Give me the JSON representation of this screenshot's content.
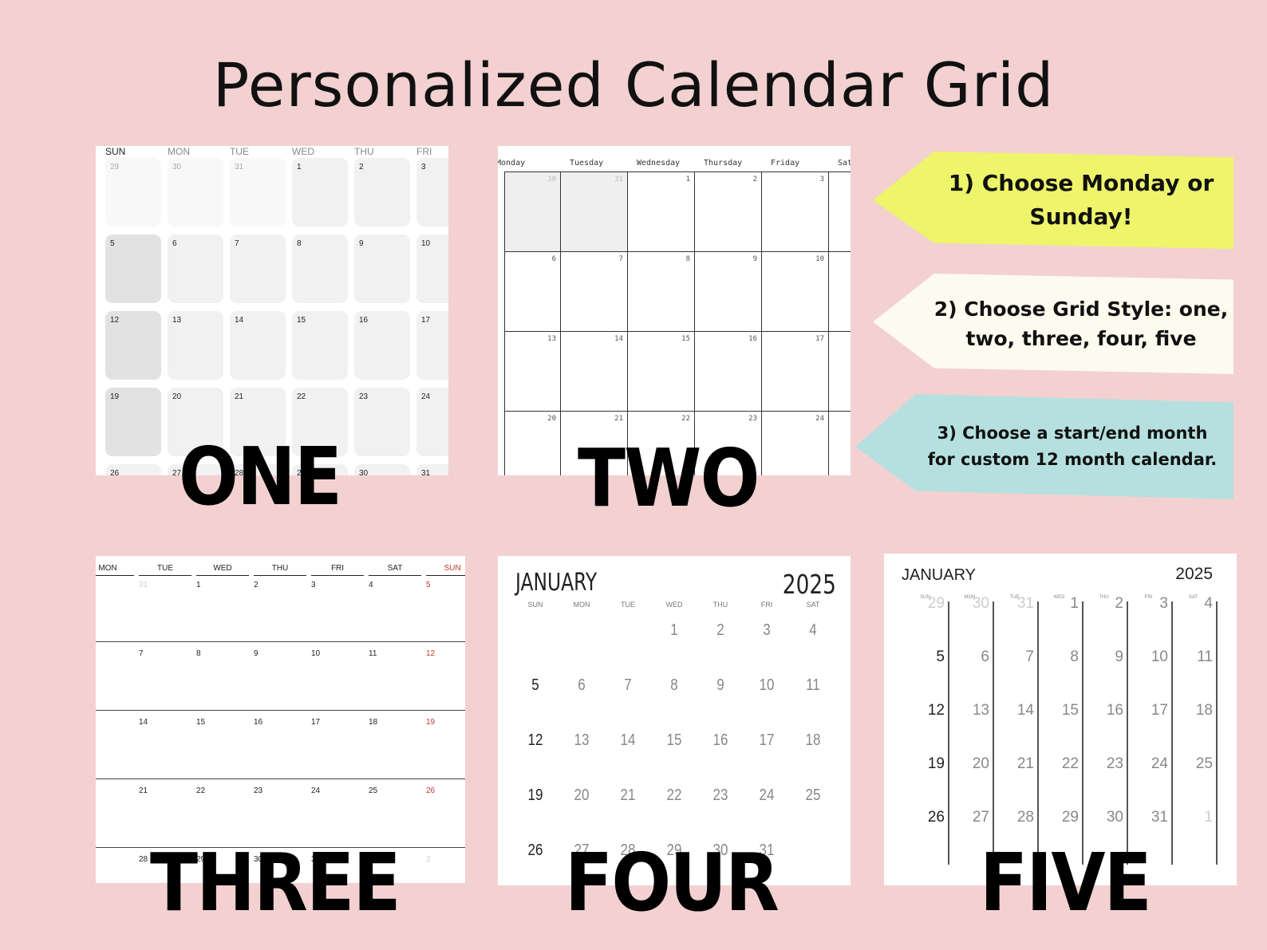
{
  "title": "Personalized Calendar Grid",
  "labels": {
    "one": "ONE",
    "two": "TWO",
    "three": "THREE",
    "four": "FOUR",
    "five": "FIVE"
  },
  "steps": [
    {
      "line1": "1) Choose Monday or",
      "line2": "Sunday!",
      "color": "#eef56a"
    },
    {
      "line1": "2) Choose Grid Style: one,",
      "line2": "two, three, four, five",
      "color": "#fdfaef"
    },
    {
      "line1": "3) Choose a start/end month",
      "line2": "for custom 12 month calendar.",
      "color": "#b5e0df"
    }
  ],
  "calendar": {
    "month": "JANUARY",
    "year": "2025",
    "p1_headers": [
      "SUN",
      "MON",
      "TUE",
      "WED",
      "THU",
      "FRI"
    ],
    "p1_rows": [
      [
        "29",
        "30",
        "31",
        "1",
        "2",
        "3"
      ],
      [
        "5",
        "6",
        "7",
        "8",
        "9",
        "10"
      ],
      [
        "12",
        "13",
        "14",
        "15",
        "16",
        "17"
      ],
      [
        "19",
        "20",
        "21",
        "22",
        "23",
        "24"
      ],
      [
        "26",
        "27",
        "28",
        "29",
        "30",
        "31"
      ]
    ],
    "p2_headers": [
      "Monday",
      "Tuesday",
      "Wednesday",
      "Thursday",
      "Friday",
      "Sat"
    ],
    "p2_rows": [
      [
        "30",
        "31",
        "1",
        "2",
        "3",
        ""
      ],
      [
        "6",
        "7",
        "8",
        "9",
        "10",
        ""
      ],
      [
        "13",
        "14",
        "15",
        "16",
        "17",
        ""
      ],
      [
        "20",
        "21",
        "22",
        "23",
        "24",
        ""
      ]
    ],
    "p3_headers": [
      "MON",
      "TUE",
      "WED",
      "THU",
      "FRI",
      "SAT",
      "SUN"
    ],
    "p3_rows": [
      [
        "31",
        "1",
        "2",
        "3",
        "4",
        "5"
      ],
      [
        "7",
        "8",
        "9",
        "10",
        "11",
        "12"
      ],
      [
        "14",
        "15",
        "16",
        "17",
        "18",
        "19"
      ],
      [
        "21",
        "22",
        "23",
        "24",
        "25",
        "26"
      ],
      [
        "28",
        "29",
        "30",
        "31",
        "",
        "2"
      ]
    ],
    "p4_headers": [
      "SUN",
      "MON",
      "TUE",
      "WED",
      "THU",
      "FRI",
      "SAT"
    ],
    "p4_rows": [
      [
        "",
        "",
        "",
        "1",
        "2",
        "3",
        "4"
      ],
      [
        "5",
        "6",
        "7",
        "8",
        "9",
        "10",
        "11"
      ],
      [
        "12",
        "13",
        "14",
        "15",
        "16",
        "17",
        "18"
      ],
      [
        "19",
        "20",
        "21",
        "22",
        "23",
        "24",
        "25"
      ],
      [
        "26",
        "27",
        "28",
        "29",
        "30",
        "31",
        ""
      ]
    ],
    "p5_headers": [
      "SUN",
      "MON",
      "TUE",
      "WED",
      "THU",
      "FRI",
      "SAT"
    ],
    "p5_rows": [
      [
        "29",
        "30",
        "31",
        "1",
        "2",
        "3",
        "4"
      ],
      [
        "5",
        "6",
        "7",
        "8",
        "9",
        "10",
        "11"
      ],
      [
        "12",
        "13",
        "14",
        "15",
        "16",
        "17",
        "18"
      ],
      [
        "19",
        "20",
        "21",
        "22",
        "23",
        "24",
        "25"
      ],
      [
        "26",
        "27",
        "28",
        "29",
        "30",
        "31",
        "1"
      ]
    ]
  }
}
